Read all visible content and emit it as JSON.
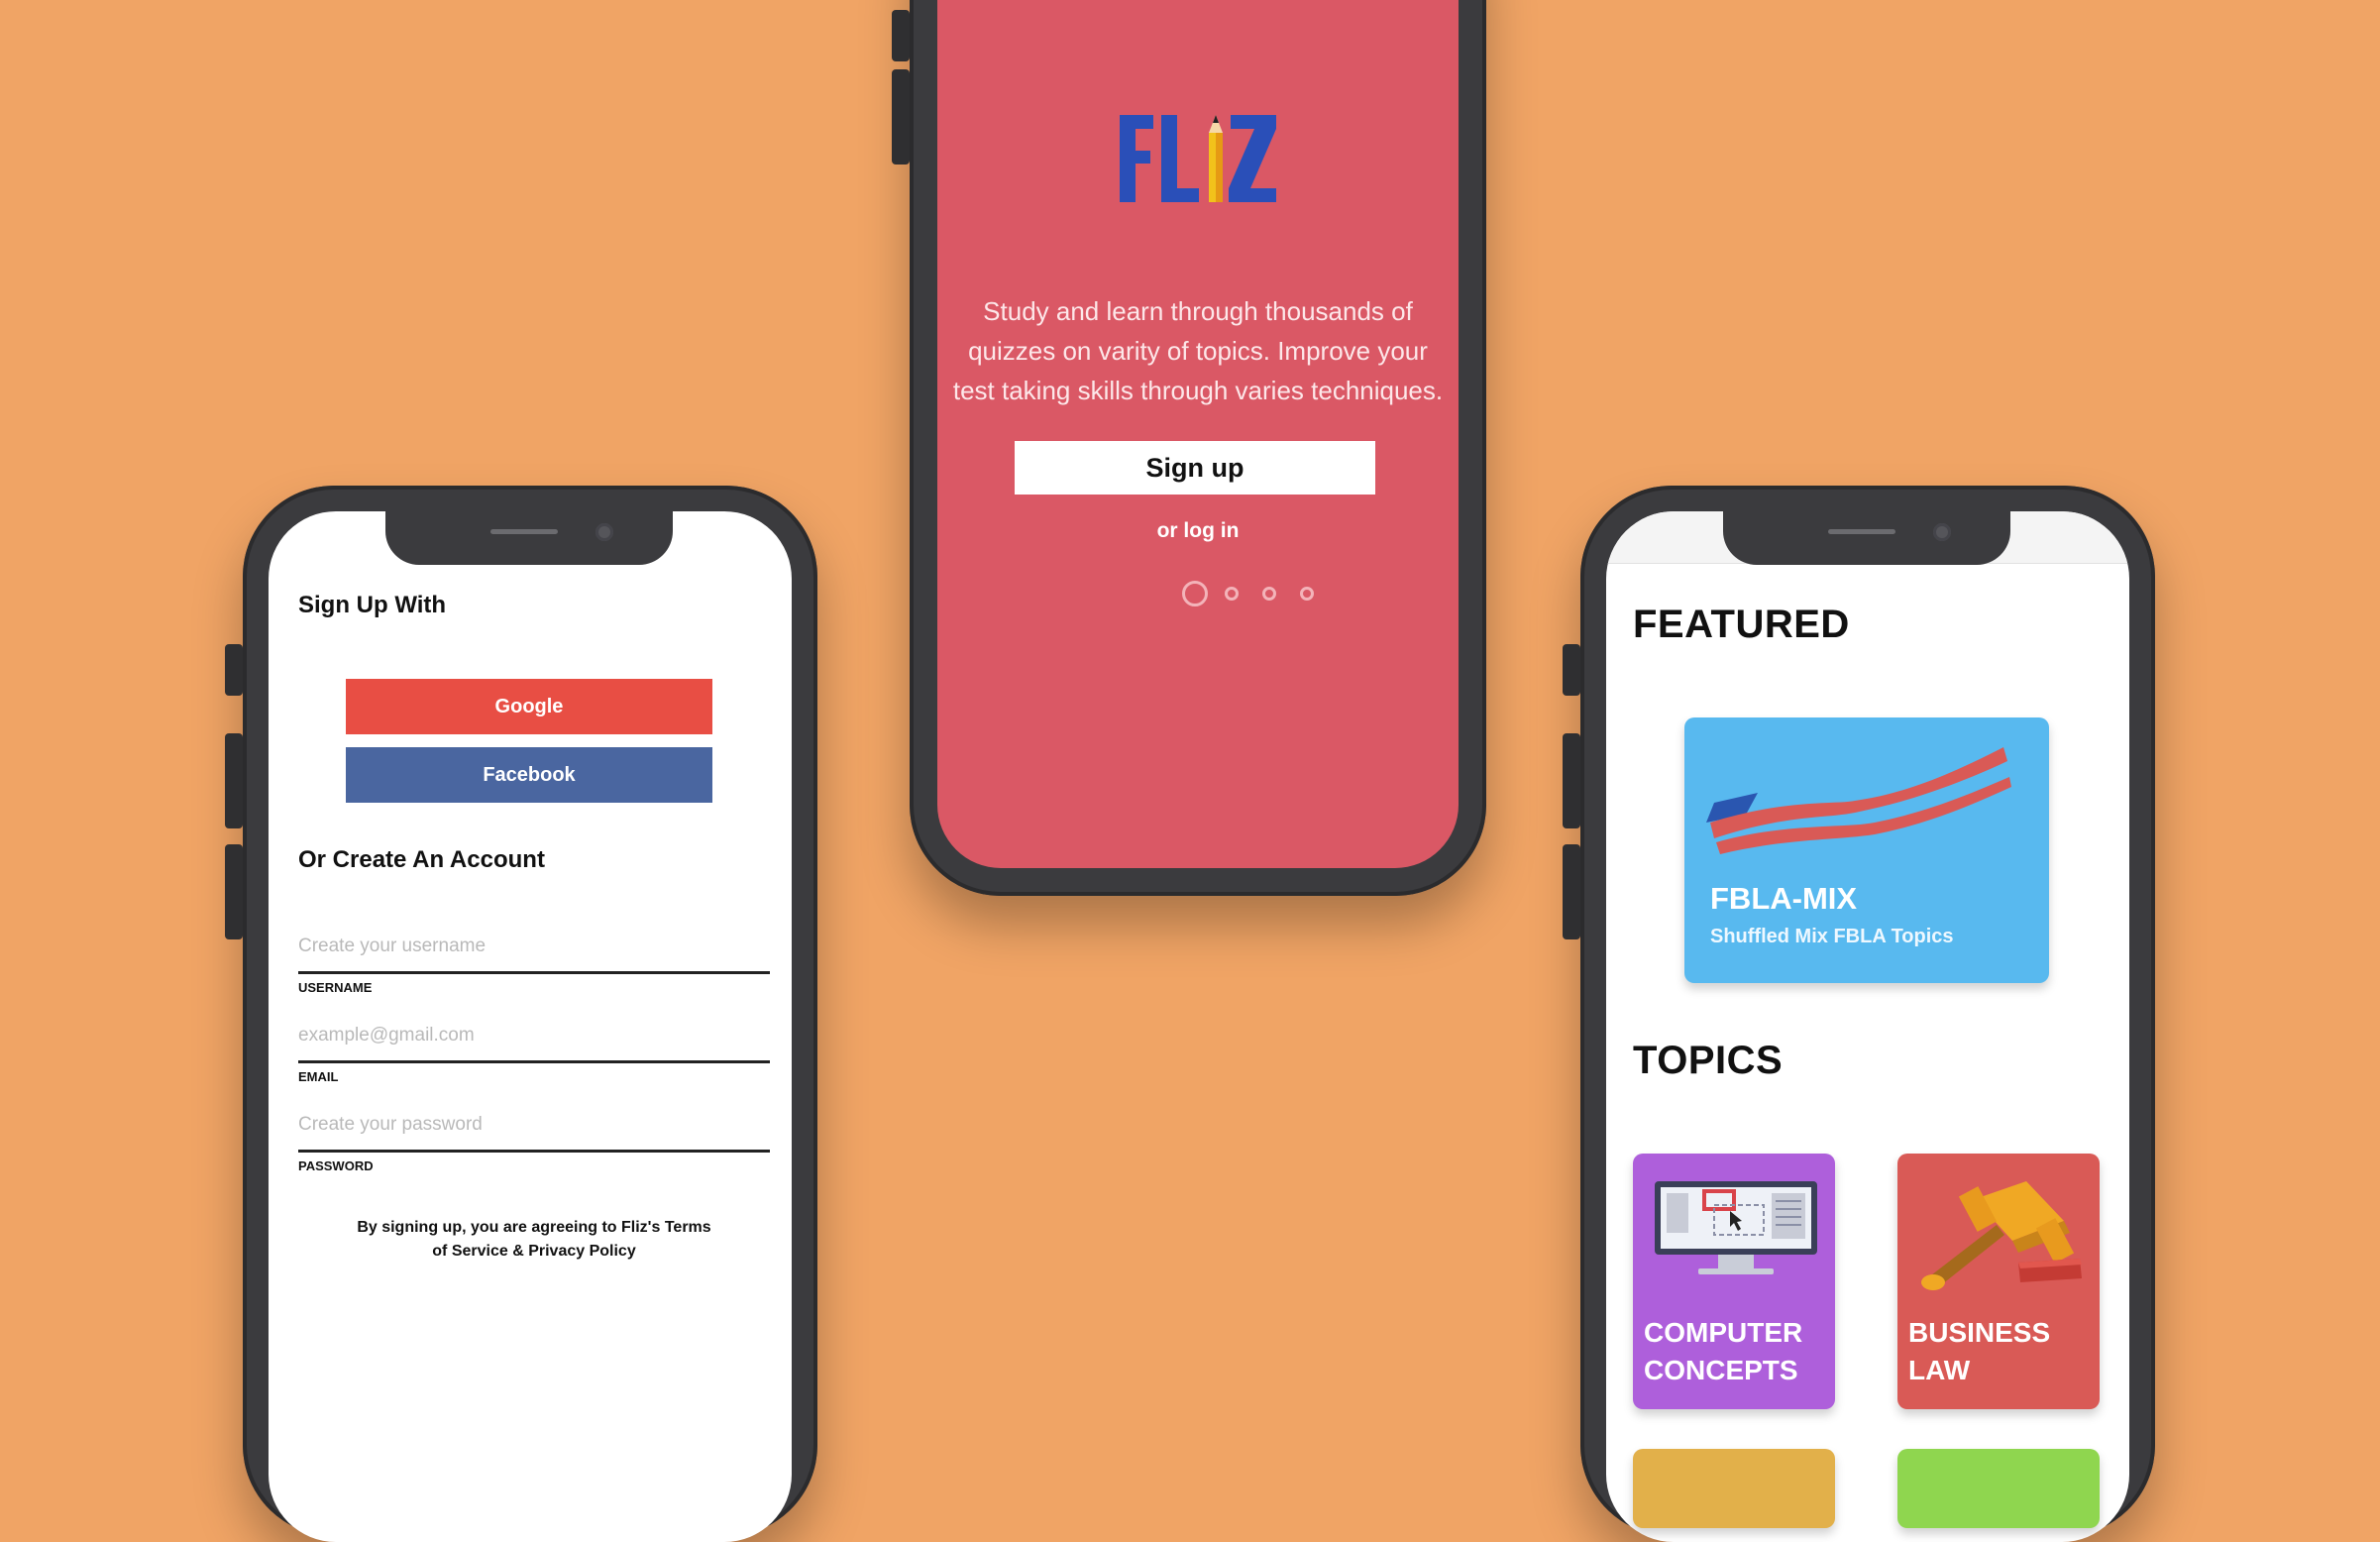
{
  "colors": {
    "background": "#f0a465",
    "phone_frame": "#3b3b3e",
    "welcome_bg": "#da5865",
    "google": "#e84e44",
    "facebook": "#4a66a0",
    "featured_card": "#58b9ef",
    "computer_concepts": "#ae5fdb",
    "business_law": "#d95a56"
  },
  "signup_screen": {
    "heading": "Sign Up With",
    "google_label": "Google",
    "facebook_label": "Facebook",
    "create_heading": "Or Create An Account",
    "username_placeholder": "Create your username",
    "username_label": "USERNAME",
    "email_placeholder": "example@gmail.com",
    "email_label": "EMAIL",
    "password_placeholder": "Create your password",
    "password_label": "PASSWORD",
    "terms_line1": "By signing up, you are agreeing to Fliz's Terms",
    "terms_line2": "of Service & Privacy Policy"
  },
  "welcome_screen": {
    "logo": "FLIZ",
    "tagline_line1": "Study and learn through thousands of",
    "tagline_line2": "quizzes on varity of topics. Improve your",
    "tagline_line3": "test taking skills through varies techniques.",
    "signup_label": "Sign up",
    "login_label": "or log in",
    "page_count": 4,
    "active_page": 1
  },
  "home_screen": {
    "featured_heading": "FEATURED",
    "featured_card": {
      "title": "FBLA-MIX",
      "subtitle": "Shuffled Mix FBLA Topics"
    },
    "topics_heading": "TOPICS",
    "topics": [
      {
        "line1": "COMPUTER",
        "line2": "CONCEPTS",
        "icon": "computer-icon"
      },
      {
        "line1": "BUSINESS",
        "line2": "LAW",
        "icon": "gavel-icon"
      }
    ]
  }
}
